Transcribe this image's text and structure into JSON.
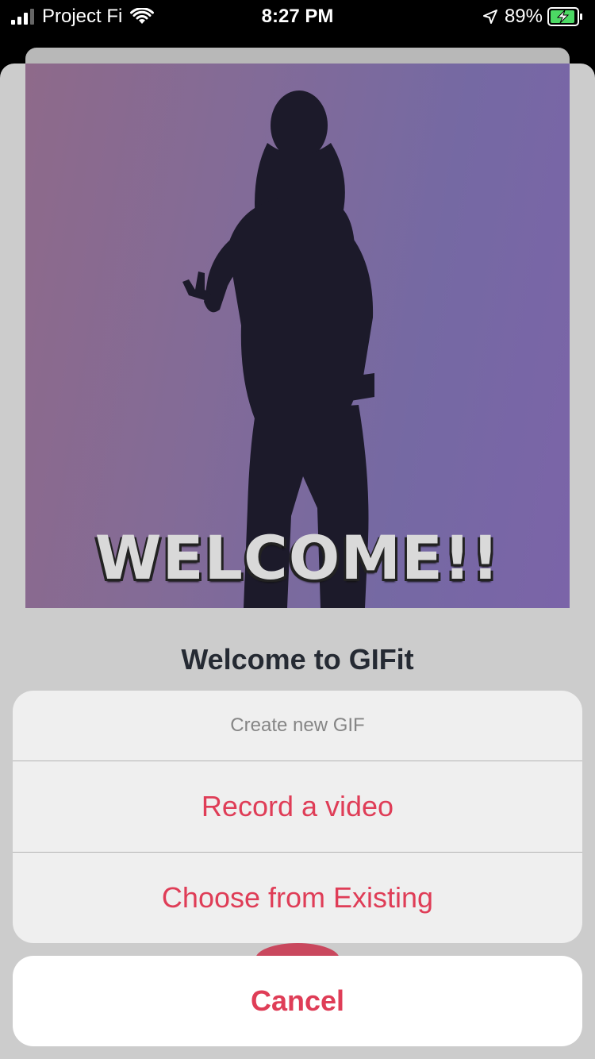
{
  "status_bar": {
    "carrier": "Project Fi",
    "time": "8:27 PM",
    "battery_percent": "89%"
  },
  "gif": {
    "caption": "WELCOME!!"
  },
  "welcome": {
    "title": "Welcome to GIFit"
  },
  "action_sheet": {
    "header": "Create new GIF",
    "options": [
      {
        "label": "Record a video"
      },
      {
        "label": "Choose from Existing"
      }
    ],
    "cancel_label": "Cancel"
  },
  "colors": {
    "accent": "#df3d57",
    "battery_fill": "#4cd964"
  }
}
